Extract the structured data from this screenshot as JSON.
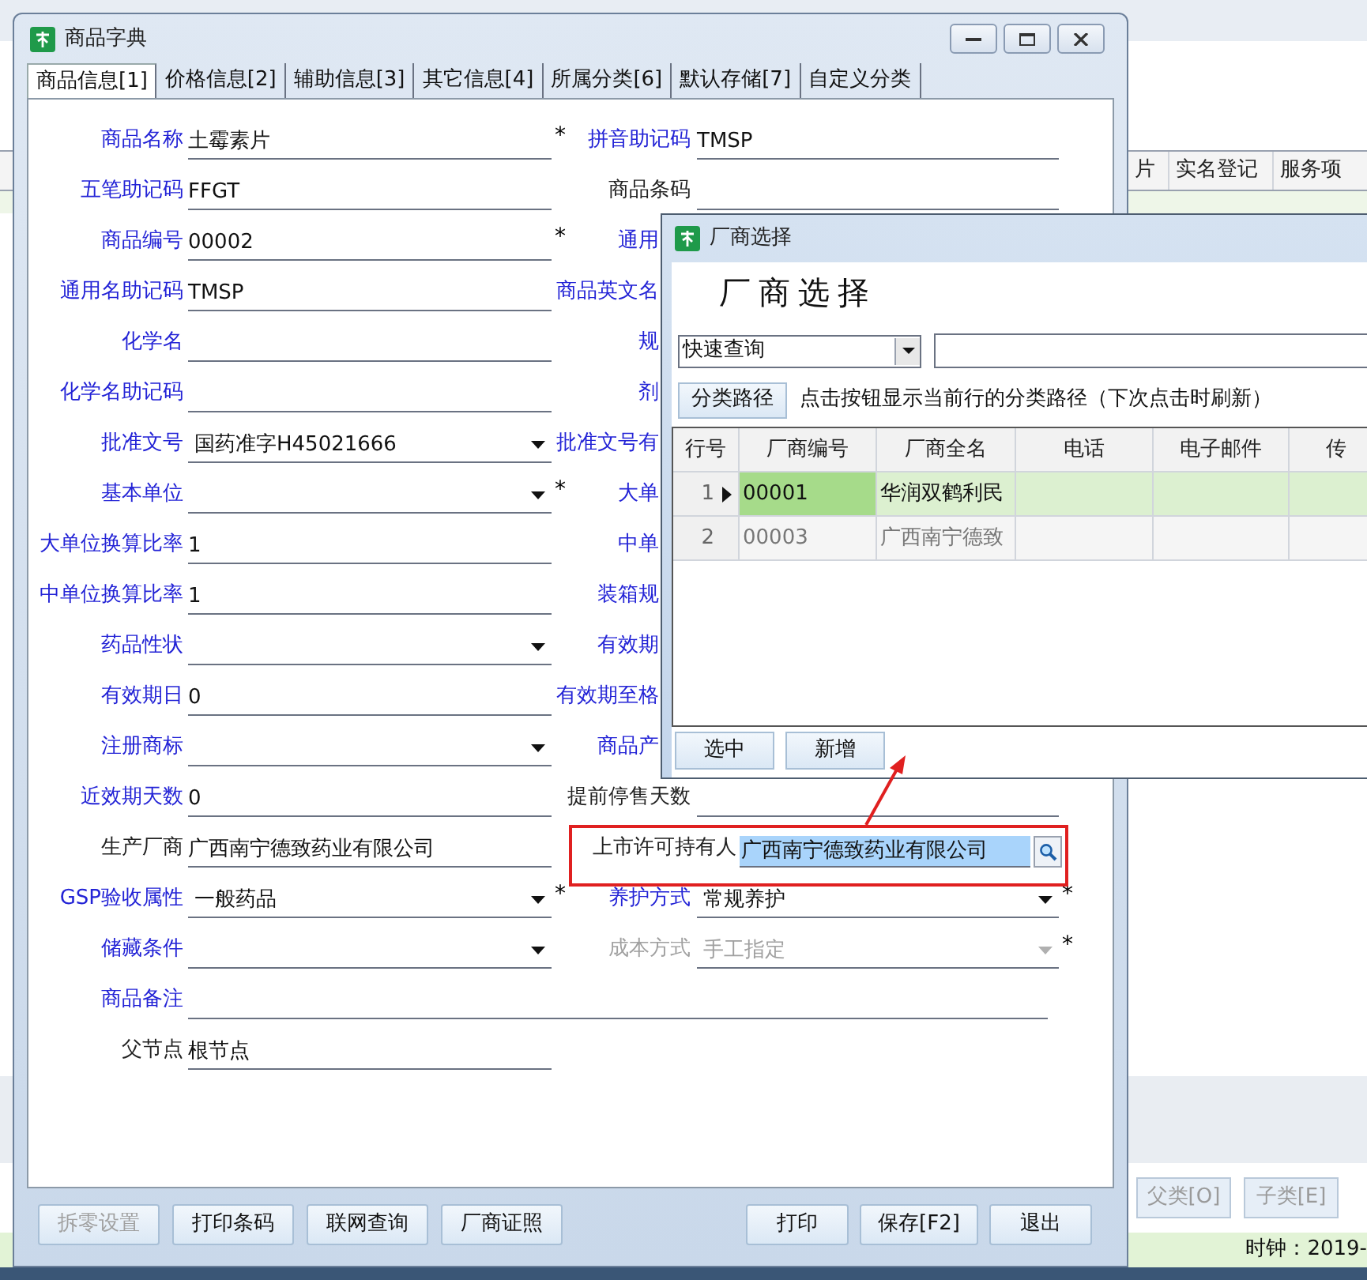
{
  "background": {
    "columns": [
      "片",
      "实名登记",
      "服务项"
    ],
    "buttons": [
      {
        "label": "父类[O]",
        "disabled": true
      },
      {
        "label": "子类[E]",
        "disabled": true
      }
    ],
    "status": "时钟：2019-"
  },
  "main_window": {
    "title": "商品字典",
    "tabs": [
      {
        "label": "商品信息[1]",
        "selected": true
      },
      {
        "label": "价格信息[2]",
        "selected": false
      },
      {
        "label": "辅助信息[3]",
        "selected": false
      },
      {
        "label": "其它信息[4]",
        "selected": false
      },
      {
        "label": "所属分类[6]",
        "selected": false
      },
      {
        "label": "默认存储[7]",
        "selected": false
      },
      {
        "label": "自定义分类",
        "selected": false
      }
    ],
    "rows": [
      {
        "left": {
          "label": "商品名称",
          "color": "#2323d6",
          "value": "土霉素片",
          "kind": "text",
          "disabled": false,
          "asterisk": "*"
        },
        "right": {
          "label": "拼音助记码",
          "color": "#2323d6",
          "value": "TMSP",
          "kind": "text",
          "disabled": false
        }
      },
      {
        "left": {
          "label": "五笔助记码",
          "color": "#2323d6",
          "value": "FFGT",
          "kind": "text",
          "disabled": false
        },
        "right": {
          "label": "商品条码",
          "color": "#222222",
          "kind": "text"
        }
      },
      {
        "left": {
          "label": "商品编号",
          "color": "#2323d6",
          "value": "00002",
          "kind": "text",
          "disabled": false,
          "asterisk": "*"
        },
        "right": {
          "label": "通用",
          "color": "#2323d6",
          "kind": "covered"
        }
      },
      {
        "left": {
          "label": "通用名助记码",
          "color": "#2323d6",
          "value": "TMSP",
          "kind": "text",
          "disabled": false
        },
        "right": {
          "label": "商品英文名",
          "color": "#2323d6",
          "kind": "covered"
        }
      },
      {
        "left": {
          "label": "化学名",
          "color": "#2323d6",
          "kind": "text"
        },
        "right": {
          "label": "规",
          "color": "#2323d6",
          "kind": "covered"
        }
      },
      {
        "left": {
          "label": "化学名助记码",
          "color": "#2323d6",
          "kind": "text"
        },
        "right": {
          "label": "剂",
          "color": "#2323d6",
          "kind": "covered"
        }
      },
      {
        "left": {
          "label": "批准文号",
          "color": "#2323d6",
          "value": "国药准字H45021666",
          "kind": "combo",
          "disabled": false
        },
        "right": {
          "label": "批准文号有",
          "color": "#2323d6",
          "kind": "covered"
        }
      },
      {
        "left": {
          "label": "基本单位",
          "color": "#2323d6",
          "kind": "combo",
          "asterisk": "*"
        },
        "right": {
          "label": "大单",
          "color": "#2323d6",
          "kind": "covered"
        }
      },
      {
        "left": {
          "label": "大单位换算比率",
          "color": "#2323d6",
          "value": "1",
          "kind": "text",
          "disabled": false
        },
        "right": {
          "label": "中单",
          "color": "#2323d6",
          "kind": "covered"
        }
      },
      {
        "left": {
          "label": "中单位换算比率",
          "color": "#2323d6",
          "value": "1",
          "kind": "text",
          "disabled": false
        },
        "right": {
          "label": "装箱规",
          "color": "#2323d6",
          "kind": "covered"
        }
      },
      {
        "left": {
          "label": "药品性状",
          "color": "#2323d6",
          "kind": "combo"
        },
        "right": {
          "label": "有效期",
          "color": "#2323d6",
          "kind": "covered"
        }
      },
      {
        "left": {
          "label": "有效期日",
          "color": "#2323d6",
          "value": "0",
          "kind": "text",
          "disabled": false
        },
        "right": {
          "label": "有效期至格",
          "color": "#2323d6",
          "kind": "covered"
        }
      },
      {
        "left": {
          "label": "注册商标",
          "color": "#2323d6",
          "kind": "combo"
        },
        "right": {
          "label": "商品产",
          "color": "#2323d6",
          "kind": "covered"
        }
      },
      {
        "left": {
          "label": "近效期天数",
          "color": "#2323d6",
          "value": "0",
          "kind": "text",
          "disabled": false
        },
        "right": {
          "label": "提前停售天数",
          "color": "#222222",
          "kind": "text"
        }
      },
      {
        "left": {
          "label": "生产厂商",
          "color": "#222222",
          "value": "广西南宁德致药业有限公司",
          "kind": "text",
          "disabled": false
        },
        "right": {
          "label": "上市许可持有人",
          "color": "#222222",
          "value": "广西南宁德致药业有限公司",
          "kind": "lookup",
          "disabled": false
        }
      },
      {
        "left": {
          "label": "GSP验收属性",
          "color": "#2323d6",
          "value": "一般药品",
          "kind": "combo",
          "disabled": false,
          "asterisk": "*"
        },
        "right": {
          "label": "养护方式",
          "color": "#2323d6",
          "value": "常规养护",
          "kind": "combo",
          "disabled": false,
          "asterisk": "*"
        }
      },
      {
        "left": {
          "label": "储藏条件",
          "color": "#2323d6",
          "kind": "combo"
        },
        "right": {
          "label": "成本方式",
          "color": "#a0a0a0",
          "value": "手工指定",
          "kind": "combo",
          "disabled": true,
          "asterisk": "*"
        }
      },
      {
        "left": {
          "label": "商品备注",
          "color": "#2323d6",
          "kind": "wide"
        }
      },
      {
        "left": {
          "label": "父节点",
          "color": "#222222",
          "value": "根节点",
          "kind": "text",
          "disabled": false
        }
      }
    ],
    "buttons_left": [
      {
        "label": "拆零设置",
        "disabled": true
      },
      {
        "label": "打印条码",
        "disabled": false
      },
      {
        "label": "联网查询",
        "disabled": false
      },
      {
        "label": "厂商证照",
        "disabled": false
      }
    ],
    "buttons_right": [
      {
        "label": "打印",
        "disabled": false
      },
      {
        "label": "保存[F2]",
        "disabled": false
      },
      {
        "label": "退出",
        "disabled": false
      }
    ]
  },
  "vendor_dialog": {
    "title": "厂商选择",
    "heading": "厂商选择",
    "query_mode": "快速查询",
    "path_button": "分类路径",
    "hint": "点击按钮显示当前行的分类路径（下次点击时刷新）",
    "columns": [
      "行号",
      "厂商编号",
      "厂商全名",
      "电话",
      "电子邮件",
      "传"
    ],
    "rows": [
      {
        "cells": [
          "1",
          "00001",
          "华润双鹤利民"
        ],
        "selected": true
      },
      {
        "cells": [
          "2",
          "00003",
          "广西南宁德致"
        ],
        "selected": false
      }
    ],
    "buttons": [
      "选中",
      "新增"
    ]
  }
}
